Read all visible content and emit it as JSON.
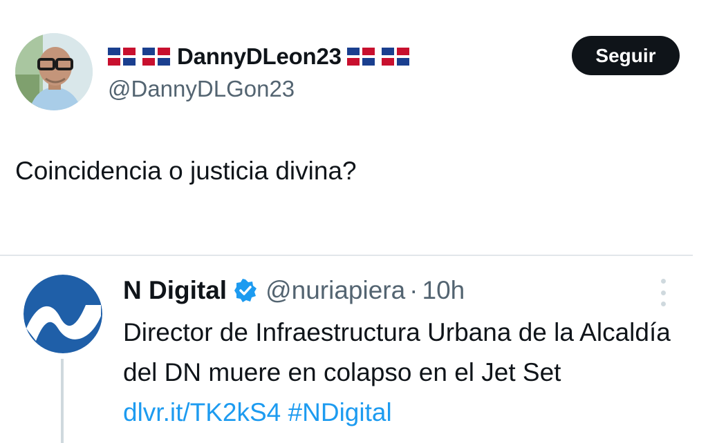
{
  "post": {
    "display_name": "DannyDLeon23",
    "handle": "@DannyDLGon23",
    "follow_label": "Seguir",
    "text": "Coincidencia o justicia divina?",
    "name_flags": [
      "dominican-republic-flag",
      "dominican-republic-flag",
      "dominican-republic-flag",
      "dominican-republic-flag"
    ]
  },
  "quoted": {
    "name": "N Digital",
    "handle": "@nuriapiera",
    "separator": "·",
    "time": "10h",
    "text": "Director de Infraestructura Urbana de la Alcaldía del DN muere en colapso en el Jet Set ",
    "link": "dlvr.it/TK2kS4",
    "hashtag": "#NDigital"
  },
  "colors": {
    "text_primary": "#0f1419",
    "text_secondary": "#536471",
    "accent": "#1d9bf0",
    "button_bg": "#0f1419",
    "ndigital_blue": "#1f5fa8"
  }
}
